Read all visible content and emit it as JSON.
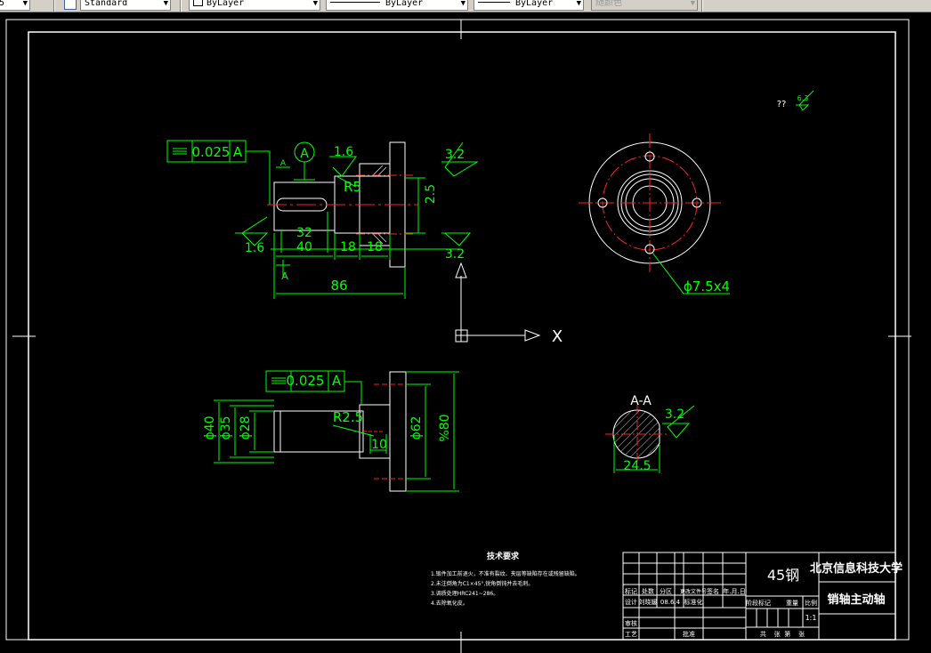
{
  "toolbar": {
    "text_style": "Standard",
    "layer": "ByLayer",
    "linetype": "ByLayer",
    "lineweight": "ByLayer",
    "plot_style": "随颜色"
  },
  "ucs": {
    "x_label": "X"
  },
  "front_view": {
    "tolerance_value": "0.025",
    "datum": "A",
    "datum_circle": "A",
    "section_mark_top": "A",
    "section_mark_bottom": "A",
    "roughness_top": "1.6",
    "roughness_right_top": "3.2",
    "roughness_right_bottom": "3.2",
    "roughness_left": "1.6",
    "dim_r5": "R5",
    "dim_25": "2.5",
    "dim_32": "32",
    "dim_40": "40",
    "dim_18a": "18",
    "dim_18b": "18",
    "dim_86": "86"
  },
  "side_view": {
    "note": "??",
    "roughness": "6.3",
    "hole_callout": "ϕ7.5x4"
  },
  "top_view": {
    "tolerance_value": "0.025",
    "datum": "A",
    "dim_r25": "R2.5",
    "dim_10": "10",
    "dim_d40": "ϕ40",
    "dim_d35": "ϕ35",
    "dim_d28": "ϕ28",
    "dim_d62": "ϕ62",
    "dim_d80": "%80"
  },
  "section_view": {
    "title": "A-A",
    "roughness": "3.2",
    "dim_245": "24.5"
  },
  "tech_req": {
    "title": "技术要求",
    "items": [
      "1.锻件加工前退火，不准有裂纹、夹层等缺陷存在或残留缺陷。",
      "2.未注倒角为C1×45°,锐角倒钝并去毛刺。",
      "3.调质处理HRC241~286。",
      "4.去除氧化皮。"
    ]
  },
  "title_block": {
    "material": "45钢",
    "school": "北京信息科技大学",
    "part_name": "销轴主动轴",
    "scale": "1:1",
    "headers": [
      "标记",
      "处数",
      "分区",
      "更改文件号",
      "签名",
      "年.月.日"
    ],
    "designer_label": "设计",
    "designer": "刘晓媛",
    "date": "08.6.4",
    "std_label": "标准化",
    "stage_labels": [
      "阶段标记",
      "重量",
      "比例"
    ],
    "review_label": "审核",
    "process_label": "工艺",
    "approve_label": "批准",
    "sheets": "共    张  第    张"
  }
}
